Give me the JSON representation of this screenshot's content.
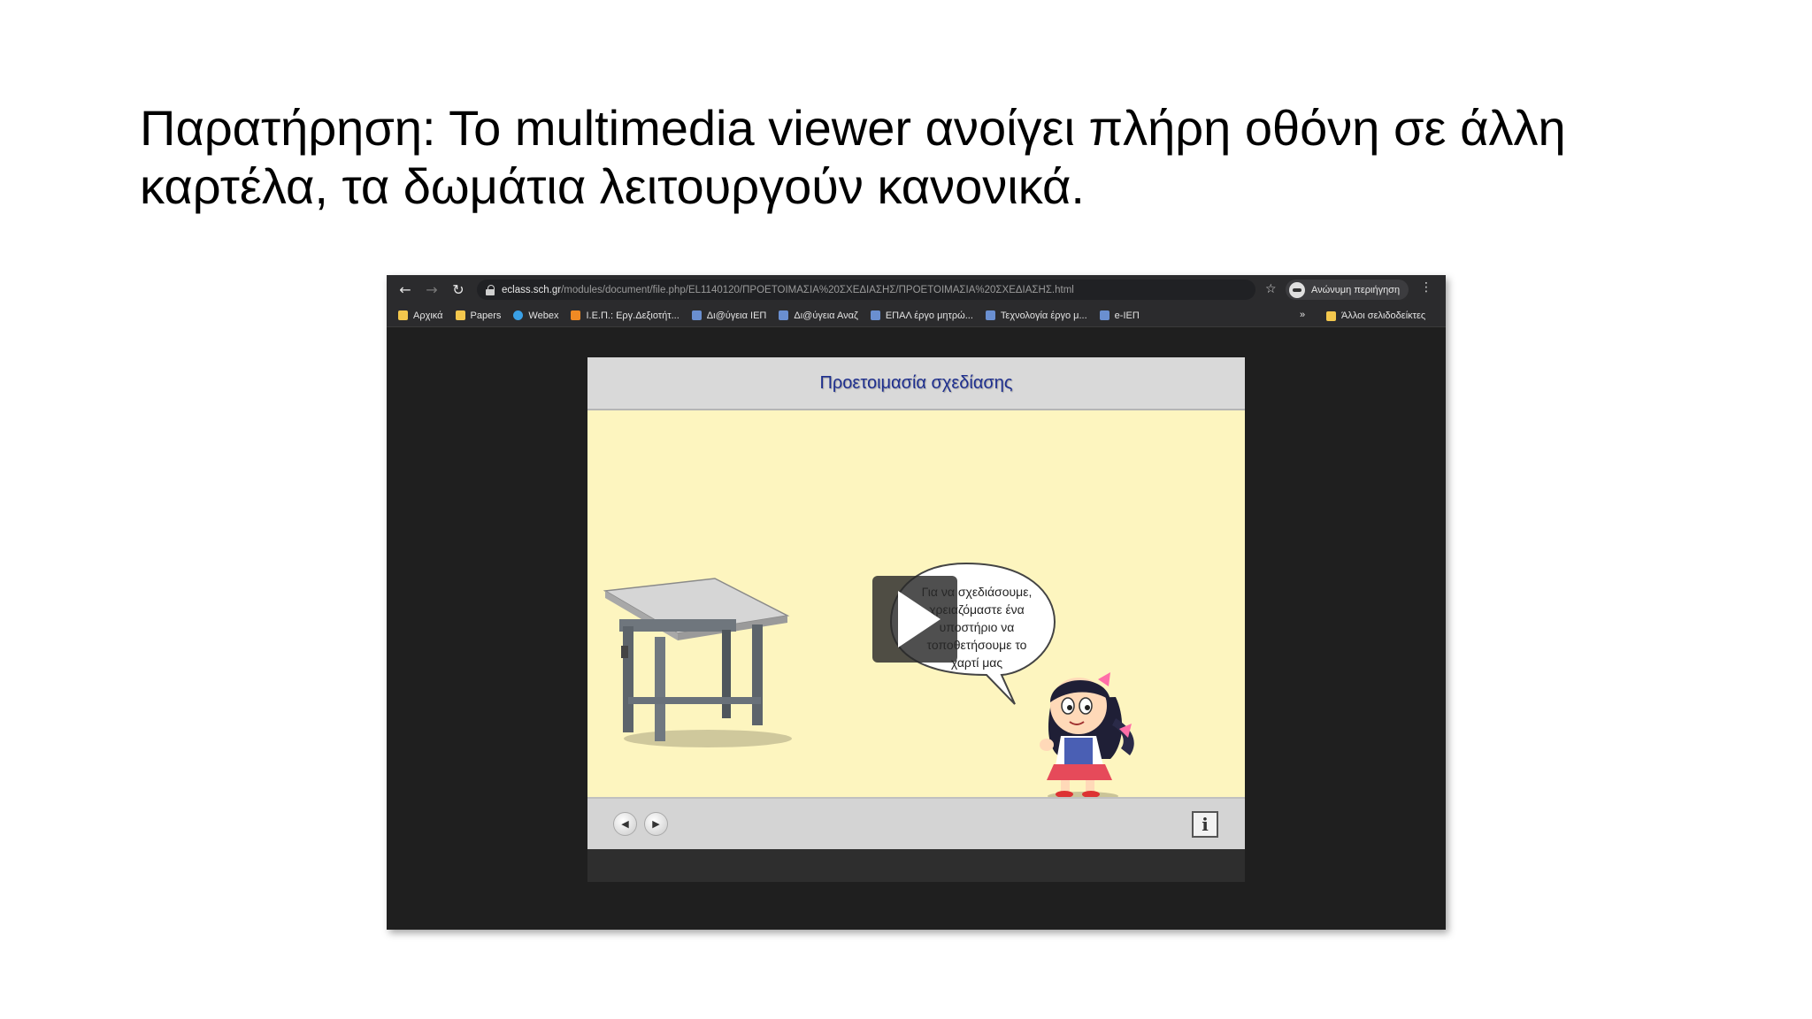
{
  "slide": {
    "title_line1": "Παρατήρηση: Το multimedia viewer ανοίγει πλήρη οθόνη σε άλλη",
    "title_line2": "καρτέλα, τα δωμάτια λειτουργούν κανονικά."
  },
  "browser": {
    "url_host": "eclass.sch.gr",
    "url_path": "/modules/document/file.php/EL1140120/ΠΡΟΕΤΟΙΜΑΣΙΑ%20ΣΧΕΔΙΑΣΗΣ/ΠΡΟΕΤΟΙΜΑΣΙΑ%20ΣΧΕΔΙΑΣΗΣ.html",
    "profile_label": "Ανώνυμη περιήγηση",
    "bookmarks": [
      {
        "label": "Αρχικά",
        "icon": "folder-icon"
      },
      {
        "label": "Papers",
        "icon": "folder-icon"
      },
      {
        "label": "Webex",
        "icon": "globe-icon"
      },
      {
        "label": "Ι.Ε.Π.: Εργ.Δεξιοτήτ...",
        "icon": "orange-icon"
      },
      {
        "label": "Δι@ύγεια ΙΕΠ",
        "icon": "iep-icon"
      },
      {
        "label": "Δι@ύγεια Αναζ",
        "icon": "iep-icon"
      },
      {
        "label": "ΕΠΑΛ έργο μητρώ...",
        "icon": "iep-icon"
      },
      {
        "label": "Τεχνολογία έργο μ...",
        "icon": "iep-icon"
      },
      {
        "label": "e-ΙΕΠ",
        "icon": "iep-icon"
      }
    ],
    "more_label": "»",
    "other_bookmarks": "Άλλοι σελιδοδείκτες"
  },
  "player": {
    "title": "Προετοιμασία σχεδίασης",
    "speech_lines": [
      "Για να σχεδιάσουμε,",
      "χρειαζόμαστε ένα",
      "υποστήριο να",
      "τοποθετήσουμε το",
      "χαρτί μας"
    ],
    "prev_symbol": "◀",
    "next_symbol": "▶",
    "info_symbol": "i"
  }
}
